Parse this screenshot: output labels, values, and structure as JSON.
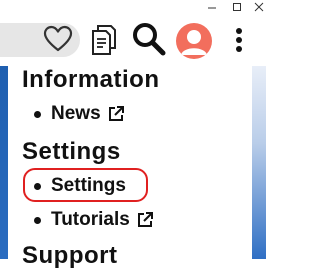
{
  "toolbar": {
    "icons": {
      "favorite": "heart-icon",
      "reader": "reader-view-icon",
      "search": "search-icon",
      "profile": "avatar-icon",
      "more": "more-vert-icon"
    }
  },
  "menu": {
    "sections": [
      {
        "title": "Information",
        "items": [
          {
            "label": "News",
            "external": true
          }
        ]
      },
      {
        "title": "Settings",
        "items": [
          {
            "label": "Settings",
            "highlighted": true
          },
          {
            "label": "Tutorials",
            "external": true
          }
        ]
      },
      {
        "title": "Support",
        "items": []
      }
    ]
  },
  "colors": {
    "avatar": "#f26e5d",
    "highlight": "#e02020",
    "side_stripe": "#1f5fb0"
  }
}
